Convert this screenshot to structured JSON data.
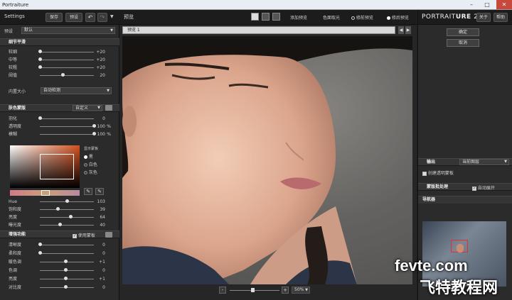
{
  "window": {
    "title": "Portraiture",
    "minimize": "–",
    "maximize": "□",
    "close": "✕"
  },
  "left": {
    "settings_label": "Settings",
    "save": "保存",
    "preset": "预设",
    "undo": "↶",
    "redo": "↷",
    "preset_label": "预设",
    "preset_value": "默认",
    "detail": {
      "title": "细节平滑",
      "rows": [
        {
          "label": "较细",
          "value": "+20",
          "knob": 0
        },
        {
          "label": "中等",
          "value": "+20",
          "knob": 0
        },
        {
          "label": "较粗",
          "value": "+20",
          "knob": 0
        },
        {
          "label": "阈值",
          "value": "20",
          "knob": 0.42
        }
      ],
      "mask_label": "内置大小",
      "mask_value": "自动检测"
    },
    "skin": {
      "title": "肤色蒙版",
      "mode": "自定义",
      "rows": [
        {
          "label": "羽化",
          "value": "0",
          "knob": 0,
          "unit": ""
        },
        {
          "label": "透明度",
          "value": "100",
          "knob": 1,
          "unit": "%"
        },
        {
          "label": "模糊",
          "value": "100",
          "knob": 1,
          "unit": "%"
        }
      ],
      "show_mask": "显示蒙板",
      "opt_a": "黑",
      "opt_b": "白色",
      "opt_c": "灰色",
      "rows2": [
        {
          "label": "Hue",
          "value": "103",
          "knob": 0.5
        },
        {
          "label": "饱和度",
          "value": "39",
          "knob": 0.33
        },
        {
          "label": "亮度",
          "value": "64",
          "knob": 0.57
        },
        {
          "label": "曝光度",
          "value": "40",
          "knob": 0.37
        }
      ]
    },
    "enhance": {
      "title": "增强功能",
      "use_mask": "使用蒙板",
      "rows": [
        {
          "label": "清晰度",
          "value": "0",
          "knob": 0
        },
        {
          "label": "柔和度",
          "value": "0",
          "knob": 0
        },
        {
          "label": "暖色调",
          "value": "+1",
          "knob": 0.47
        },
        {
          "label": "色调",
          "value": "0",
          "knob": 0.47
        },
        {
          "label": "亮度",
          "value": "+1",
          "knob": 0.47
        },
        {
          "label": "对比度",
          "value": "0",
          "knob": 0.47
        }
      ]
    }
  },
  "center": {
    "preview_label": "预览",
    "add_preview": "添加预览",
    "pick_color": "色面取光",
    "before_preview": "修前预览",
    "after_preview": "修后预览",
    "tab": "预览 1",
    "zoom": "50%",
    "minus": "-",
    "plus": "+"
  },
  "right": {
    "logo_a": "PORTRAIT",
    "logo_b": "URE",
    "logo_c": "2",
    "about": "关于",
    "help": "帮助",
    "ok": "确定",
    "cancel": "取消",
    "output_title": "输出",
    "output_value": "当前图层",
    "output_check": "创建透明蒙板",
    "batch_title": "蒙版批处理",
    "batch_check": "自动展开",
    "navigator_title": "导航器",
    "watermark_a": "fevte.com",
    "watermark_b": "飞特教程网"
  },
  "colors": {
    "accent": "#6e95c4",
    "panel": "#2b2b2b",
    "header": "#353535"
  }
}
